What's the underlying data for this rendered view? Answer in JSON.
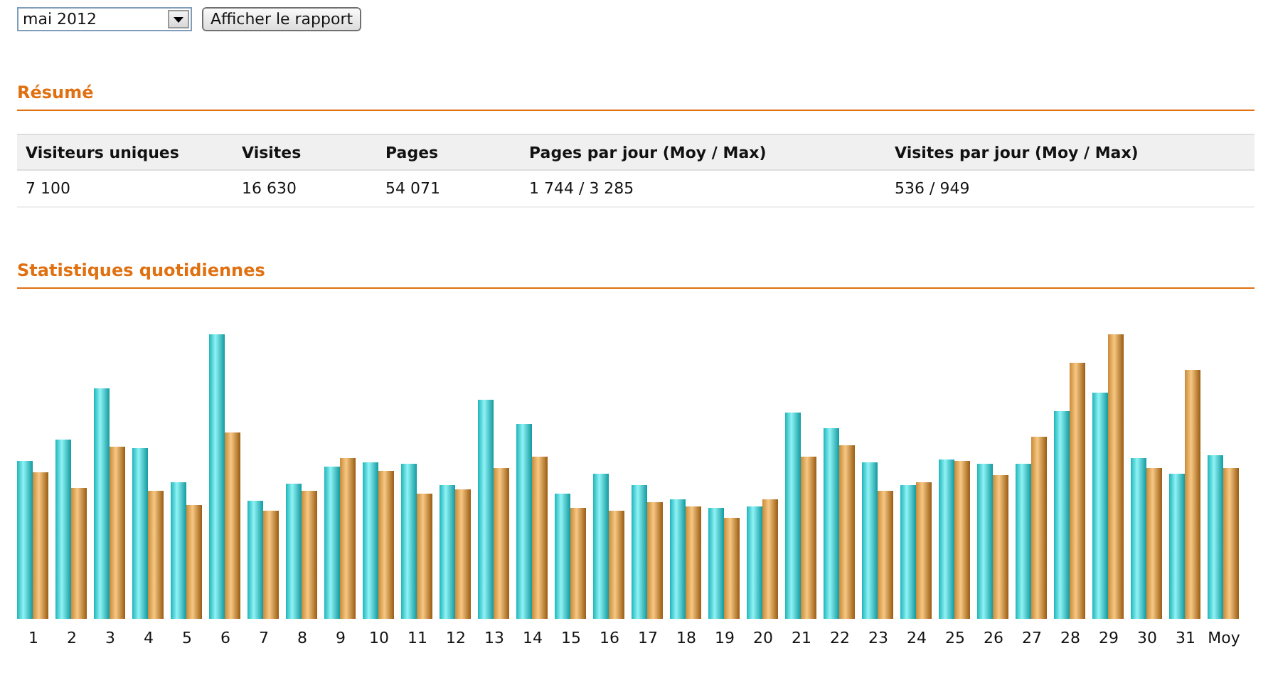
{
  "period_select": {
    "value": "mai 2012"
  },
  "report_button": {
    "label": "Afficher le rapport"
  },
  "summary": {
    "title": "Résumé",
    "columns": [
      "Visiteurs uniques",
      "Visites",
      "Pages",
      "Pages par jour (Moy / Max)",
      "Visites par jour (Moy / Max)"
    ],
    "rows": [
      [
        "7 100",
        "16 630",
        "54 071",
        "1 744 / 3 285",
        "536 / 949"
      ]
    ]
  },
  "daily": {
    "title": "Statistiques quotidiennes",
    "day_labels": [
      "1",
      "2",
      "3",
      "4",
      "5",
      "6",
      "7",
      "8",
      "9",
      "10",
      "11",
      "12",
      "13",
      "14",
      "15",
      "16",
      "17",
      "18",
      "19",
      "20",
      "21",
      "22",
      "23",
      "24",
      "25",
      "26",
      "27",
      "28",
      "29",
      "30",
      "31",
      "Moy"
    ]
  }
}
